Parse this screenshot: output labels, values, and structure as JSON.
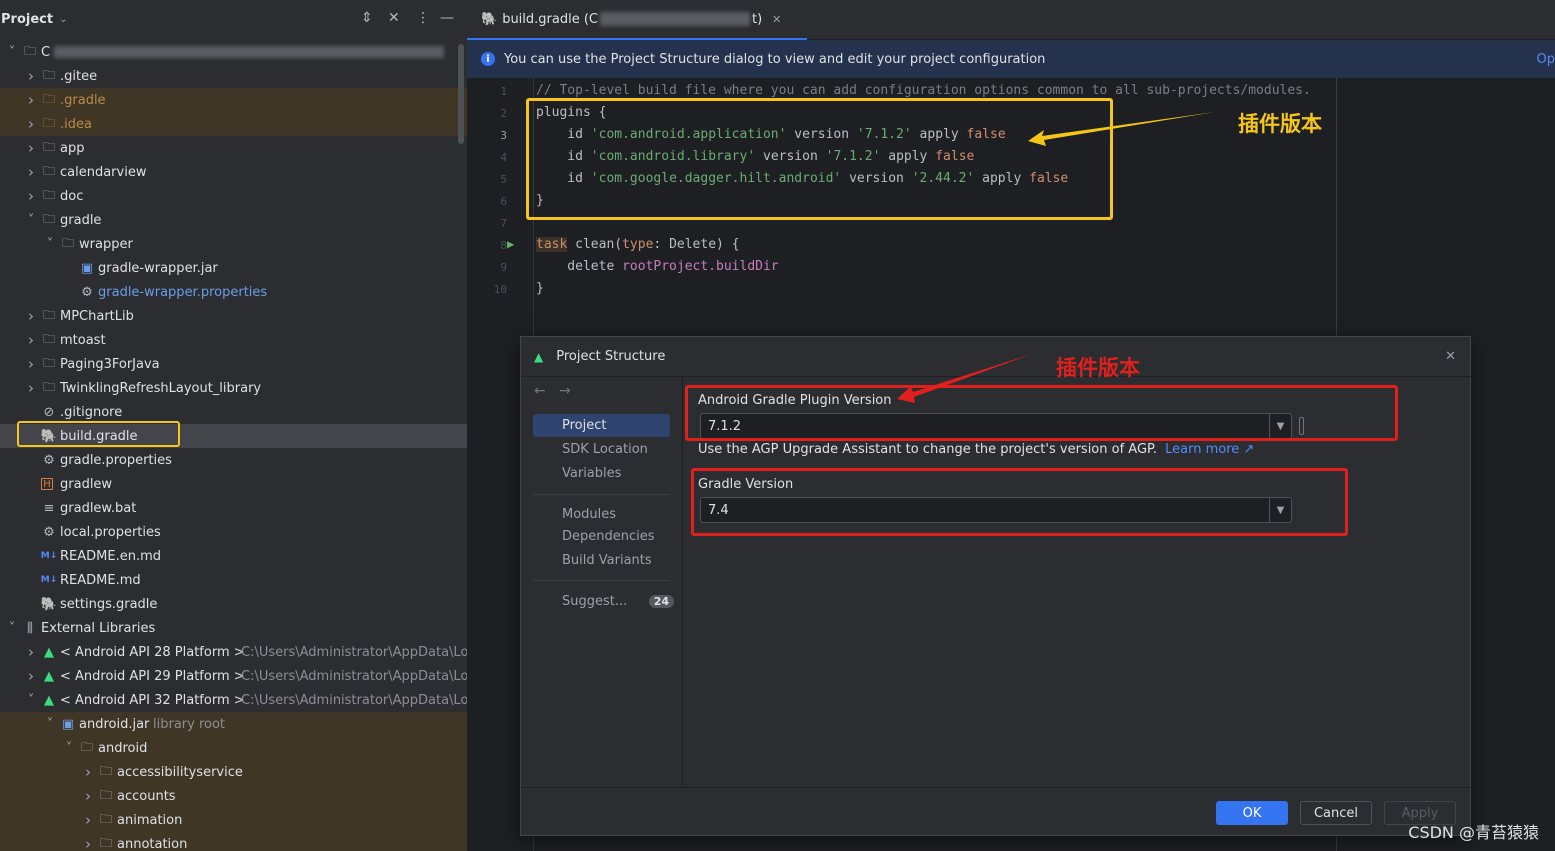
{
  "project_panel": {
    "title": "Project",
    "tree": [
      {
        "label": "C",
        "icon": "module-icon",
        "chevron": "open",
        "style": "bold",
        "redacted": true
      },
      {
        "label": ".gitee",
        "icon": "folder-icon",
        "chevron": "closed",
        "style": "normal"
      },
      {
        "label": ".gradle",
        "icon": "folder-icon",
        "chevron": "closed",
        "style": "orange"
      },
      {
        "label": ".idea",
        "icon": "folder-icon",
        "chevron": "closed",
        "style": "orange"
      },
      {
        "label": "app",
        "icon": "module-icon",
        "chevron": "closed",
        "style": "bold"
      },
      {
        "label": "calendarview",
        "icon": "module-icon",
        "chevron": "closed",
        "style": "bold"
      },
      {
        "label": "doc",
        "icon": "folder-icon",
        "chevron": "closed",
        "style": "normal"
      },
      {
        "label": "gradle",
        "icon": "folder-icon",
        "chevron": "open",
        "style": "normal"
      },
      {
        "label": "wrapper",
        "icon": "folder-icon",
        "chevron": "open",
        "style": "normal"
      },
      {
        "label": "gradle-wrapper.jar",
        "icon": "jar-icon",
        "chevron": "none",
        "style": "normal"
      },
      {
        "label": "gradle-wrapper.properties",
        "icon": "settings-file-icon",
        "chevron": "none",
        "style": "blue"
      },
      {
        "label": "MPChartLib",
        "icon": "module-icon",
        "chevron": "closed",
        "style": "bold"
      },
      {
        "label": "mtoast",
        "icon": "module-icon",
        "chevron": "closed",
        "style": "bold"
      },
      {
        "label": "Paging3ForJava",
        "icon": "module-icon",
        "chevron": "closed",
        "style": "bold"
      },
      {
        "label": "TwinklingRefreshLayout_library",
        "icon": "module-icon",
        "chevron": "closed",
        "style": "bold"
      },
      {
        "label": ".gitignore",
        "icon": "ignore-file-icon",
        "chevron": "none",
        "style": "normal"
      },
      {
        "label": "build.gradle",
        "icon": "gradle-elephant-icon",
        "chevron": "none",
        "style": "normal",
        "selected": true
      },
      {
        "label": "gradle.properties",
        "icon": "settings-file-icon",
        "chevron": "none",
        "style": "normal"
      },
      {
        "label": "gradlew",
        "icon": "shell-script-icon",
        "chevron": "none",
        "style": "normal"
      },
      {
        "label": "gradlew.bat",
        "icon": "text-file-icon",
        "chevron": "none",
        "style": "normal"
      },
      {
        "label": "local.properties",
        "icon": "settings-file-icon",
        "chevron": "none",
        "style": "normal"
      },
      {
        "label": "README.en.md",
        "icon": "markdown-icon",
        "chevron": "none",
        "style": "normal"
      },
      {
        "label": "README.md",
        "icon": "markdown-icon",
        "chevron": "none",
        "style": "normal"
      },
      {
        "label": "settings.gradle",
        "icon": "gradle-elephant-icon",
        "chevron": "none",
        "style": "normal"
      },
      {
        "label": "External Libraries",
        "icon": "library-icon",
        "chevron": "open",
        "style": "normal"
      },
      {
        "label": "< Android API 28 Platform >",
        "suffix": "C:\\Users\\Administrator\\AppData\\Loc",
        "icon": "android-icon",
        "chevron": "closed",
        "style": "normal"
      },
      {
        "label": "< Android API 29 Platform >",
        "suffix": "C:\\Users\\Administrator\\AppData\\Loc",
        "icon": "android-icon",
        "chevron": "closed",
        "style": "normal"
      },
      {
        "label": "< Android API 32 Platform >",
        "suffix": "C:\\Users\\Administrator\\AppData\\Loc",
        "icon": "android-icon",
        "chevron": "open",
        "style": "normal"
      },
      {
        "label": "android.jar",
        "suffix": "library root",
        "icon": "jar-icon",
        "chevron": "open",
        "style": "normal"
      },
      {
        "label": "android",
        "icon": "folder-icon",
        "chevron": "open",
        "style": "normal"
      },
      {
        "label": "accessibilityservice",
        "icon": "folder-icon",
        "chevron": "closed",
        "style": "normal"
      },
      {
        "label": "accounts",
        "icon": "folder-icon",
        "chevron": "closed",
        "style": "normal"
      },
      {
        "label": "animation",
        "icon": "folder-icon",
        "chevron": "closed",
        "style": "normal"
      },
      {
        "label": "annotation",
        "icon": "folder-icon",
        "chevron": "closed",
        "style": "normal"
      }
    ]
  },
  "editor": {
    "tab_label": "build.gradle (C",
    "tab_label_end": "t)",
    "banner_text": "You can use the Project Structure dialog to view and edit your project configuration",
    "banner_link": "Op",
    "lines": [
      {
        "n": "1",
        "parts": [
          {
            "t": "// Top-level build file where you can add configuration options common to all sub-projects/modules.",
            "c": "cm"
          }
        ]
      },
      {
        "n": "2",
        "parts": [
          {
            "t": "plugins {",
            "c": ""
          }
        ]
      },
      {
        "n": "3",
        "parts": [
          {
            "t": "    id ",
            "c": ""
          },
          {
            "t": "'com.android.application'",
            "c": "str"
          },
          {
            "t": " version ",
            "c": ""
          },
          {
            "t": "'7.1.2'",
            "c": "str"
          },
          {
            "t": " apply ",
            "c": ""
          },
          {
            "t": "false",
            "c": "kw"
          }
        ]
      },
      {
        "n": "4",
        "parts": [
          {
            "t": "    id ",
            "c": ""
          },
          {
            "t": "'com.android.library'",
            "c": "str"
          },
          {
            "t": " version ",
            "c": ""
          },
          {
            "t": "'7.1.2'",
            "c": "str"
          },
          {
            "t": " apply ",
            "c": ""
          },
          {
            "t": "false",
            "c": "kw"
          }
        ]
      },
      {
        "n": "5",
        "parts": [
          {
            "t": "    id ",
            "c": ""
          },
          {
            "t": "'com.google.dagger.hilt.android'",
            "c": "str"
          },
          {
            "t": " version ",
            "c": ""
          },
          {
            "t": "'2.44.2'",
            "c": "str"
          },
          {
            "t": " apply ",
            "c": ""
          },
          {
            "t": "false",
            "c": "kw"
          }
        ]
      },
      {
        "n": "6",
        "parts": [
          {
            "t": "}",
            "c": ""
          }
        ]
      },
      {
        "n": "7",
        "parts": []
      },
      {
        "n": "8",
        "parts": [
          {
            "t": "task",
            "c": "kw"
          },
          {
            "t": " clean(",
            "c": ""
          },
          {
            "t": "type",
            "c": "kw"
          },
          {
            "t": ": Delete) {",
            "c": ""
          }
        ]
      },
      {
        "n": "9",
        "parts": [
          {
            "t": "    delete ",
            "c": ""
          },
          {
            "t": "rootProject.buildDir",
            "c": "fld"
          }
        ]
      },
      {
        "n": "10",
        "parts": [
          {
            "t": "}",
            "c": ""
          }
        ]
      }
    ]
  },
  "dialog": {
    "title": "Project Structure",
    "nav_top": [
      "Project",
      "SDK Location",
      "Variables"
    ],
    "nav_mid": [
      "Modules",
      "Dependencies",
      "Build Variants"
    ],
    "nav_suggest": "Suggest...",
    "nav_suggest_count": "24",
    "agp_label": "Android Gradle Plugin Version",
    "agp_value": "7.1.2",
    "agp_hint": "Use the AGP Upgrade Assistant to change the project's version of AGP.",
    "agp_hint_link": "Learn more ↗",
    "gradle_label": "Gradle Version",
    "gradle_value": "7.4",
    "ok": "OK",
    "cancel": "Cancel",
    "apply": "Apply"
  },
  "annotations": {
    "editor_note": "插件版本",
    "dialog_note": "插件版本",
    "highlight_yellow": "#f5c518",
    "highlight_red": "#e0201c"
  },
  "watermark": "CSDN @青苔猿猿"
}
